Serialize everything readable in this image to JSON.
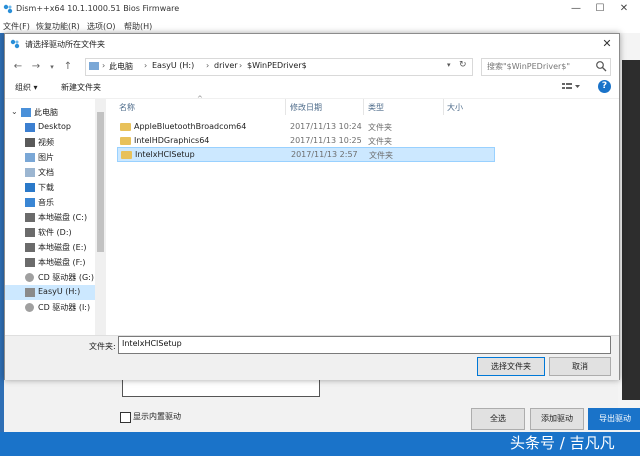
{
  "main_window": {
    "title": "Dism++x64 10.1.1000.51 Bios Firmware",
    "menu": [
      "文件(F)",
      "恢复功能(R)",
      "选项(O)",
      "帮助(H)"
    ],
    "controls": {
      "minimize": "—",
      "maximize": "☐",
      "close": "✕"
    }
  },
  "background": {
    "checkbox_label": "显示内置驱动",
    "btn_select_all": "全选",
    "btn_add": "添加驱动",
    "btn_export": "导出驱动",
    "watermark": "头条号 / 吉凡凡"
  },
  "dialog": {
    "title": "请选择驱动所在文件夹",
    "close": "✕",
    "breadcrumbs": [
      "此电脑",
      "EasyU (H:)",
      "driver",
      "$WinPEDriver$"
    ],
    "search_placeholder": "搜索\"$WinPEDriver$\"",
    "toolbar": {
      "organize": "组织 ▾",
      "new_folder": "新建文件夹",
      "help": "?"
    },
    "nav_tree": [
      {
        "label": "此电脑",
        "icon": "pc-icon"
      },
      {
        "label": "Desktop",
        "icon": "desktop-icon"
      },
      {
        "label": "视频",
        "icon": "video-icon"
      },
      {
        "label": "图片",
        "icon": "pictures-icon"
      },
      {
        "label": "文档",
        "icon": "documents-icon"
      },
      {
        "label": "下载",
        "icon": "downloads-icon"
      },
      {
        "label": "音乐",
        "icon": "music-icon"
      },
      {
        "label": "本地磁盘 (C:)",
        "icon": "drive-icon"
      },
      {
        "label": "软件 (D:)",
        "icon": "drive-icon"
      },
      {
        "label": "本地磁盘 (E:)",
        "icon": "drive-icon"
      },
      {
        "label": "本地磁盘 (F:)",
        "icon": "drive-icon"
      },
      {
        "label": "CD 驱动器 (G:)",
        "icon": "cd-drive-icon"
      },
      {
        "label": "EasyU (H:)",
        "icon": "usb-drive-icon",
        "selected": true
      },
      {
        "label": "CD 驱动器 (I:)",
        "icon": "cd-drive-icon"
      }
    ],
    "columns": [
      "名称",
      "修改日期",
      "类型",
      "大小"
    ],
    "files": [
      {
        "name": "AppleBluetoothBroadcom64",
        "date": "2017/11/13 10:24",
        "type": "文件夹",
        "size": ""
      },
      {
        "name": "IntelHDGraphics64",
        "date": "2017/11/13 10:25",
        "type": "文件夹",
        "size": ""
      },
      {
        "name": "IntelxHCISetup",
        "date": "2017/11/13 2:57",
        "type": "文件夹",
        "size": "",
        "selected": true
      }
    ],
    "folder_label": "文件夹:",
    "folder_value": "IntelxHCISetup",
    "btn_select_folder": "选择文件夹",
    "btn_cancel": "取消"
  },
  "colors": {
    "accent": "#1a73c9",
    "selection": "#cce8ff",
    "folder": "#e8c15a"
  }
}
